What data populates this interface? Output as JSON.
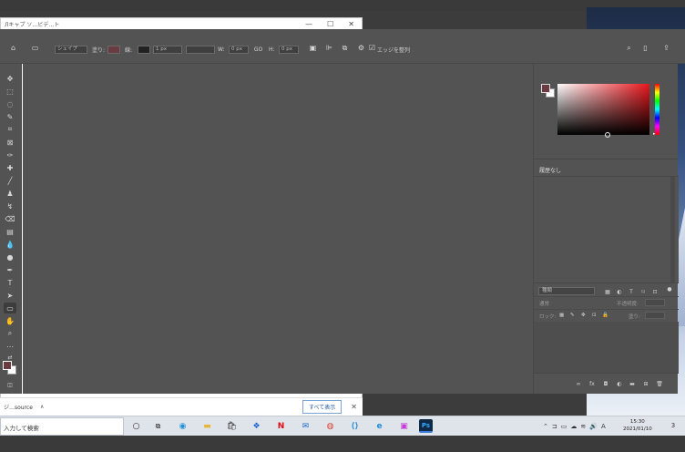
{
  "background_window": {
    "tabs": [
      "Лキャプ ソ…ビデ…ト",
      "",
      "",
      ""
    ],
    "controls": [
      "—",
      "☐",
      "✕"
    ]
  },
  "notification_bar": {
    "item": "ジ…source",
    "chevron": "∧",
    "show_all_label": "すべて表示",
    "close_label": "✕"
  },
  "options_bar": {
    "shape_mode": "シェイプ",
    "fill_label": "塗り:",
    "stroke_label": "線:",
    "stroke_width": "1 px",
    "w_label": "W:",
    "w_value": "0 px",
    "link": "GO",
    "h_label": "H:",
    "h_value": "0 px",
    "align_edges_label": "エッジを整列"
  },
  "color_panel": {
    "fg_color": "#6b3b42",
    "bg_color": "#ffffff",
    "accent": "#e8161c"
  },
  "history_panel": {
    "title": "履歴なし"
  },
  "layers_panel": {
    "search_placeholder": "種類",
    "blend_label": "通常",
    "opacity_label": "不透明度:",
    "lock_label": "ロック:",
    "fill_label": "塗り:"
  },
  "taskbar": {
    "search_text": "入力して検索",
    "time": "15:30",
    "date": "2021/01/10",
    "ime": "A",
    "notification_count": "3",
    "apps": [
      "cortana",
      "task-view",
      "edge",
      "file-explorer",
      "store",
      "dropbox",
      "netflix",
      "mail",
      "chrome",
      "vscode",
      "ie",
      "photos",
      "photoshop"
    ]
  }
}
